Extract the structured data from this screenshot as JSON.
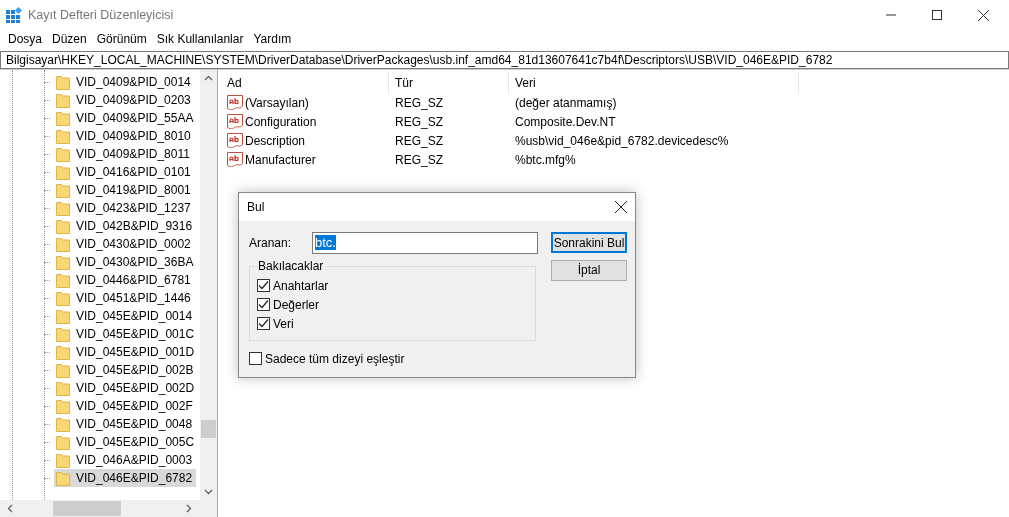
{
  "window": {
    "title": "Kayıt Defteri Düzenleyicisi"
  },
  "menu": [
    "Dosya",
    "Düzen",
    "Görünüm",
    "Sık Kullanılanlar",
    "Yardım"
  ],
  "address": "Bilgisayar\\HKEY_LOCAL_MACHINE\\SYSTEM\\DriverDatabase\\DriverPackages\\usb.inf_amd64_81d13607641c7b4f\\Descriptors\\USB\\VID_046E&PID_6782",
  "tree": {
    "items": [
      {
        "label": "VID_0409&PID_0014",
        "selected": false
      },
      {
        "label": "VID_0409&PID_0203",
        "selected": false
      },
      {
        "label": "VID_0409&PID_55AA",
        "selected": false
      },
      {
        "label": "VID_0409&PID_8010",
        "selected": false
      },
      {
        "label": "VID_0409&PID_8011",
        "selected": false
      },
      {
        "label": "VID_0416&PID_0101",
        "selected": false
      },
      {
        "label": "VID_0419&PID_8001",
        "selected": false
      },
      {
        "label": "VID_0423&PID_1237",
        "selected": false
      },
      {
        "label": "VID_042B&PID_9316",
        "selected": false
      },
      {
        "label": "VID_0430&PID_0002",
        "selected": false
      },
      {
        "label": "VID_0430&PID_36BA",
        "selected": false
      },
      {
        "label": "VID_0446&PID_6781",
        "selected": false
      },
      {
        "label": "VID_0451&PID_1446",
        "selected": false
      },
      {
        "label": "VID_045E&PID_0014",
        "selected": false
      },
      {
        "label": "VID_045E&PID_001C",
        "selected": false
      },
      {
        "label": "VID_045E&PID_001D",
        "selected": false
      },
      {
        "label": "VID_045E&PID_002B",
        "selected": false
      },
      {
        "label": "VID_045E&PID_002D",
        "selected": false
      },
      {
        "label": "VID_045E&PID_002F",
        "selected": false
      },
      {
        "label": "VID_045E&PID_0048",
        "selected": false
      },
      {
        "label": "VID_045E&PID_005C",
        "selected": false
      },
      {
        "label": "VID_046A&PID_0003",
        "selected": false
      },
      {
        "label": "VID_046E&PID_6782",
        "selected": true
      }
    ]
  },
  "values": {
    "columns": [
      "Ad",
      "Tür",
      "Veri"
    ],
    "rows": [
      {
        "name": "(Varsayılan)",
        "type": "REG_SZ",
        "data": "(değer atanmamış)"
      },
      {
        "name": "Configuration",
        "type": "REG_SZ",
        "data": "Composite.Dev.NT"
      },
      {
        "name": "Description",
        "type": "REG_SZ",
        "data": "%usb\\vid_046e&pid_6782.devicedesc%"
      },
      {
        "name": "Manufacturer",
        "type": "REG_SZ",
        "data": "%btc.mfg%"
      }
    ]
  },
  "find_dialog": {
    "title": "Bul",
    "search_label": "Aranan:",
    "search_value": "btc.",
    "find_next_button": "Sonrakini Bul",
    "cancel_button": "İptal",
    "look_at": {
      "title": "Bakılacaklar",
      "options": [
        {
          "label": "Anahtarlar",
          "checked": true
        },
        {
          "label": "Değerler",
          "checked": true
        },
        {
          "label": "Veri",
          "checked": true
        }
      ]
    },
    "match_whole": {
      "label": "Sadece tüm dizeyi eşleştir",
      "checked": false
    }
  }
}
